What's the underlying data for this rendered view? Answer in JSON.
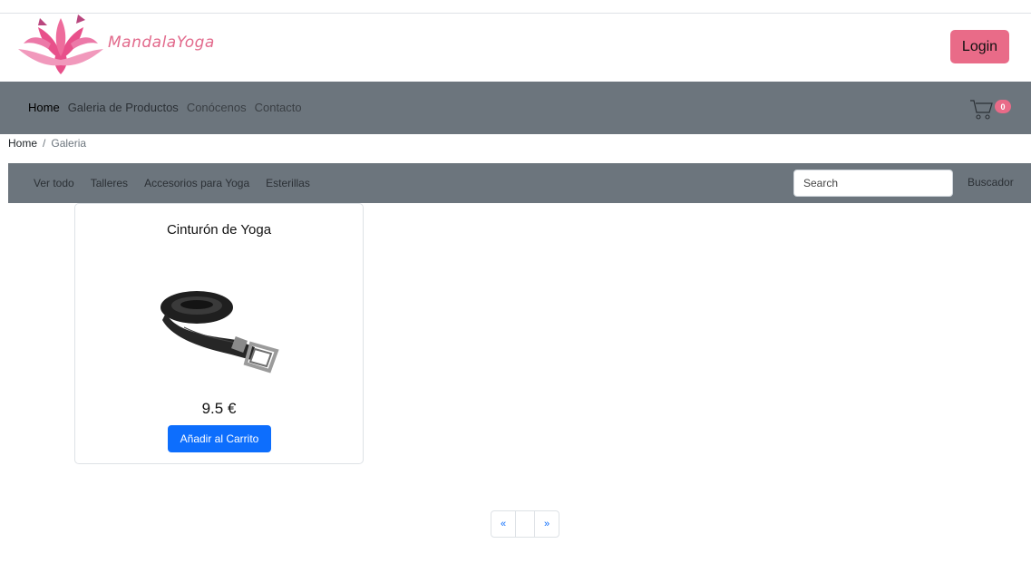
{
  "brand": {
    "name": "MandalaYoga",
    "logo_icon": "lotus-icon",
    "logo_colors": [
      "#e8508a",
      "#b9467e",
      "#f199bc"
    ]
  },
  "header": {
    "login_label": "Login"
  },
  "navbar": {
    "items": [
      {
        "label": "Home"
      },
      {
        "label": "Galeria de Productos"
      },
      {
        "label": "Conócenos"
      },
      {
        "label": "Contacto"
      }
    ],
    "cart": {
      "icon": "cart-icon",
      "count": "0"
    }
  },
  "breadcrumb": {
    "home": "Home",
    "separator": "/",
    "current": "Galeria"
  },
  "filters": {
    "items": [
      {
        "label": "Ver todo"
      },
      {
        "label": "Talleres"
      },
      {
        "label": "Accesorios para Yoga"
      },
      {
        "label": "Esterillas"
      }
    ],
    "search_placeholder": "Search",
    "search_button": "Buscador"
  },
  "products": [
    {
      "title": "Cinturón de Yoga",
      "image": "yoga-strap-image",
      "price": "9.5 €",
      "add_label": "Añadir al Carrito"
    }
  ],
  "pagination": {
    "prev": "«",
    "next": "»"
  },
  "colors": {
    "navbar": "#6c757d",
    "accent": "#e96b88",
    "primary": "#0d6efd"
  }
}
